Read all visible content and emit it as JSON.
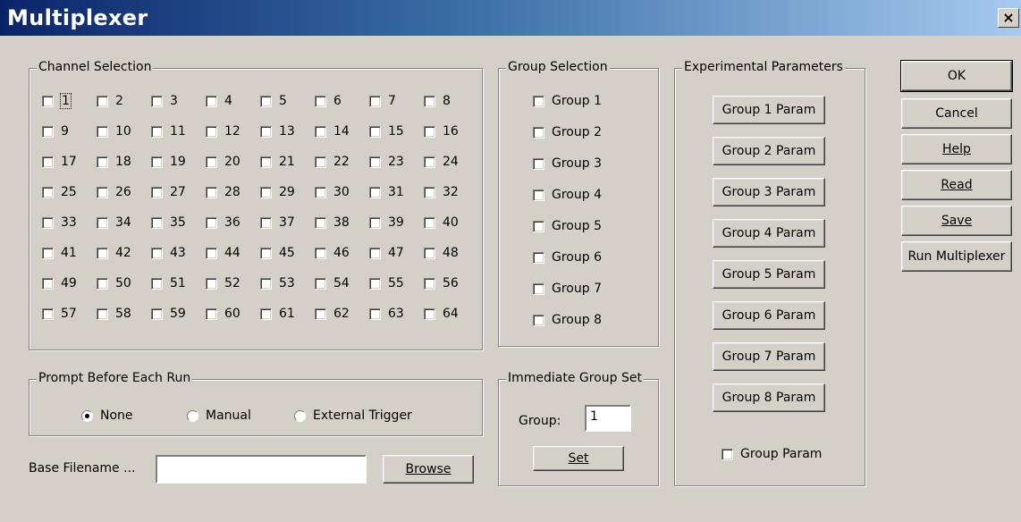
{
  "window": {
    "title": "Multiplexer",
    "close_label": "×"
  },
  "channel_selection": {
    "legend": "Channel Selection",
    "channels": [
      "1",
      "2",
      "3",
      "4",
      "5",
      "6",
      "7",
      "8",
      "9",
      "10",
      "11",
      "12",
      "13",
      "14",
      "15",
      "16",
      "17",
      "18",
      "19",
      "20",
      "21",
      "22",
      "23",
      "24",
      "25",
      "26",
      "27",
      "28",
      "29",
      "30",
      "31",
      "32",
      "33",
      "34",
      "35",
      "36",
      "37",
      "38",
      "39",
      "40",
      "41",
      "42",
      "43",
      "44",
      "45",
      "46",
      "47",
      "48",
      "49",
      "50",
      "51",
      "52",
      "53",
      "54",
      "55",
      "56",
      "57",
      "58",
      "59",
      "60",
      "61",
      "62",
      "63",
      "64"
    ]
  },
  "group_selection": {
    "legend": "Group Selection",
    "groups": [
      "Group 1",
      "Group 2",
      "Group 3",
      "Group 4",
      "Group 5",
      "Group 6",
      "Group 7",
      "Group 8"
    ]
  },
  "experimental_parameters": {
    "legend": "Experimental Parameters",
    "buttons": [
      "Group 1 Param",
      "Group 2 Param",
      "Group 3 Param",
      "Group 4 Param",
      "Group 5 Param",
      "Group 6 Param",
      "Group 7 Param",
      "Group 8 Param"
    ],
    "group_param_label": "Group Param"
  },
  "prompt": {
    "legend": "Prompt Before Each Run",
    "options": [
      "None",
      "Manual",
      "External Trigger"
    ],
    "selected": "None"
  },
  "immediate_group_set": {
    "legend": "Immediate Group Set",
    "group_label": "Group:",
    "group_value": "1",
    "set_label": "Set"
  },
  "base_filename": {
    "label": "Base Filename ...",
    "value": "",
    "browse_label": "Browse"
  },
  "actions": {
    "ok": "OK",
    "cancel": "Cancel",
    "help": "Help",
    "read": "Read",
    "save": "Save",
    "run": "Run Multiplexer"
  }
}
